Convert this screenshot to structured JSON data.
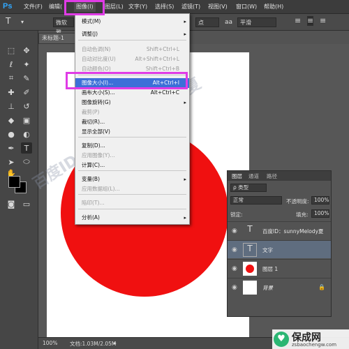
{
  "menubar": {
    "logo": "Ps",
    "items": [
      "文件(F)",
      "编辑(",
      "图像(I)",
      "图层(L)",
      "文字(Y)",
      "选择(S)",
      "滤镜(T)",
      "视图(V)",
      "窗口(W)",
      "帮助(H)"
    ]
  },
  "options_bar": {
    "font_family": "微软雅",
    "font_size": "点",
    "antialias": "平滑",
    "tool_glyph": "T"
  },
  "document_tab": {
    "label": "未标题-1"
  },
  "image_menu": {
    "items": [
      {
        "label": "模式(M)",
        "shortcut": "",
        "arrow": "▸",
        "disabled": false
      },
      {
        "label": "调整(J)",
        "shortcut": "",
        "arrow": "▸",
        "disabled": false
      },
      {
        "label": "自动色调(N)",
        "shortcut": "Shift+Ctrl+L",
        "arrow": "",
        "disabled": true
      },
      {
        "label": "自动对比度(U)",
        "shortcut": "Alt+Shift+Ctrl+L",
        "arrow": "",
        "disabled": true
      },
      {
        "label": "自动颜色(O)",
        "shortcut": "Shift+Ctrl+B",
        "arrow": "",
        "disabled": true
      },
      {
        "label": "图像大小(I)...",
        "shortcut": "Alt+Ctrl+I",
        "arrow": "",
        "disabled": false
      },
      {
        "label": "画布大小(S)...",
        "shortcut": "Alt+Ctrl+C",
        "arrow": "",
        "disabled": false
      },
      {
        "label": "图像旋转(G)",
        "shortcut": "",
        "arrow": "▸",
        "disabled": false
      },
      {
        "label": "裁剪(P)",
        "shortcut": "",
        "arrow": "",
        "disabled": true
      },
      {
        "label": "裁切(R)...",
        "shortcut": "",
        "arrow": "",
        "disabled": false
      },
      {
        "label": "显示全部(V)",
        "shortcut": "",
        "arrow": "",
        "disabled": false
      },
      {
        "label": "复制(D)...",
        "shortcut": "",
        "arrow": "",
        "disabled": false
      },
      {
        "label": "应用图像(Y)...",
        "shortcut": "",
        "arrow": "",
        "disabled": true
      },
      {
        "label": "计算(C)...",
        "shortcut": "",
        "arrow": "",
        "disabled": false
      },
      {
        "label": "变量(B)",
        "shortcut": "",
        "arrow": "▸",
        "disabled": false
      },
      {
        "label": "应用数据组(L)...",
        "shortcut": "",
        "arrow": "",
        "disabled": true
      },
      {
        "label": "陷印(T)...",
        "shortcut": "",
        "arrow": "",
        "disabled": true
      },
      {
        "label": "分析(A)",
        "shortcut": "",
        "arrow": "▸",
        "disabled": false
      }
    ]
  },
  "layers_panel": {
    "tabs": [
      "图层",
      "通道",
      "路径"
    ],
    "filter_label": "ρ 类型",
    "blend_mode": "正常",
    "opacity_label": "不透明度:",
    "opacity_value": "100%",
    "lock_label": "锁定:",
    "fill_label": "填充:",
    "fill_value": "100%",
    "layers": [
      {
        "name": "百度ID：sunnyMelody夏",
        "kind": "text",
        "selected": false
      },
      {
        "name": "文字",
        "kind": "text",
        "selected": true
      },
      {
        "name": "图层 1",
        "kind": "circle",
        "selected": false
      },
      {
        "name": "背景",
        "kind": "background",
        "selected": false
      }
    ]
  },
  "status_bar": {
    "zoom": "100%",
    "doc_info": "文档:1.03M/2.05M"
  },
  "watermark": {
    "text": "百度ID：sunnyMelody夏"
  },
  "site_badge": {
    "logo": "♥",
    "title": "保成网",
    "url": "zsbaochengw.com"
  },
  "colors": {
    "accent": "#e03ce6",
    "red_circle": "#f01010",
    "menu_highlight": "#3c6fd8"
  }
}
